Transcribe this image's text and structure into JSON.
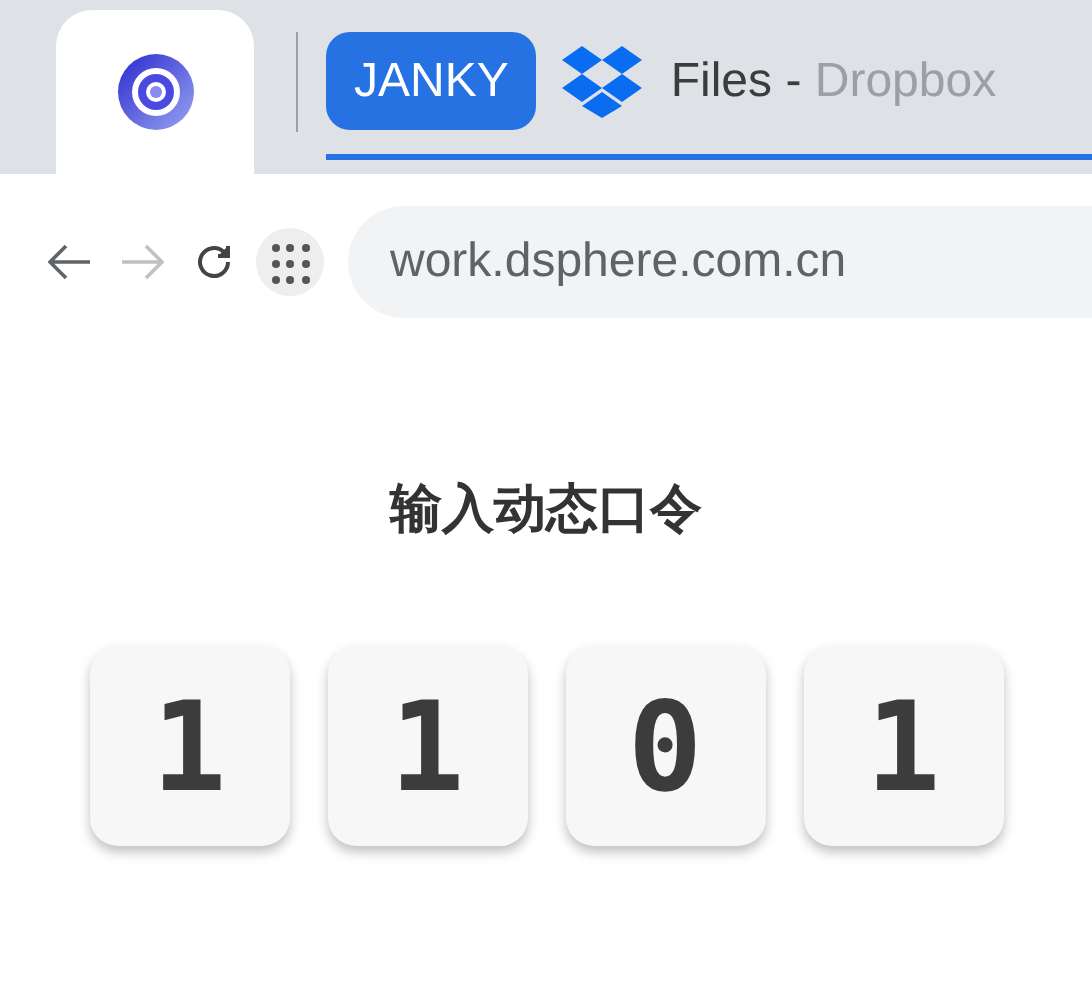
{
  "tabs": [
    {
      "kind": "app",
      "selected": true
    },
    {
      "kind": "group",
      "label": "JANKY"
    },
    {
      "kind": "page",
      "title": "Files -",
      "site": "Dropbox",
      "selected": false
    }
  ],
  "toolbar": {
    "back_disabled": false,
    "forward_disabled": true,
    "url": "work.dsphere.com.cn"
  },
  "page": {
    "heading": "输入动态口令",
    "digits": [
      "1",
      "1",
      "0",
      "1"
    ]
  }
}
